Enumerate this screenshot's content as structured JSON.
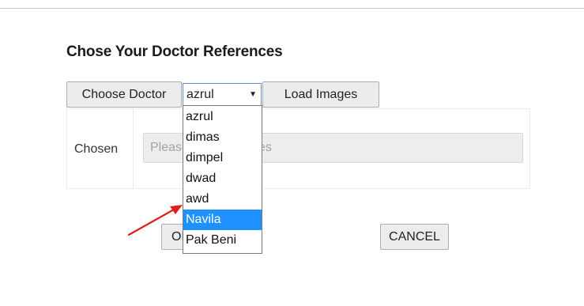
{
  "page": {
    "heading": "Chose Your Doctor References"
  },
  "toolbar": {
    "choose_doctor_label": "Choose Doctor",
    "selected_doctor": "azrul",
    "load_images_label": "Load Images"
  },
  "doctor_dropdown": {
    "options": [
      "azrul",
      "dimas",
      "dimpel",
      "dwad",
      "awd",
      "Navila",
      "Pak Beni"
    ],
    "highlighted": "Navila"
  },
  "chosen": {
    "label": "Chosen",
    "placeholder": "Please select choices"
  },
  "actions": {
    "ok_label": "OK",
    "cancel_label": "CANCEL"
  },
  "annotation": {
    "arrow_color": "#e0201c"
  },
  "colors": {
    "selected_option_bg": "#1e90ff",
    "select_focus_border": "#5b8fd6"
  }
}
